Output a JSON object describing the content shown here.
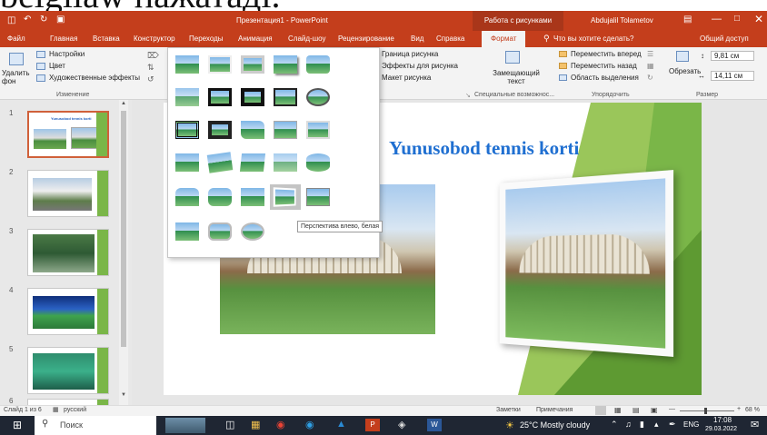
{
  "caption_text": "belgilaw нажатадi.",
  "app": {
    "title": "Презентация1 - PowerPoint",
    "context_tab": "Работа с рисунками",
    "user": "Abdujalil Tolametov"
  },
  "tabs": [
    "Файл",
    "Главная",
    "Вставка",
    "Конструктор",
    "Переходы",
    "Анимация",
    "Слайд-шоу",
    "Рецензирование",
    "Вид",
    "Справка",
    "Формат"
  ],
  "tell_me": "Что вы хотите сделать?",
  "share": "Общий доступ",
  "ribbon": {
    "remove_bg": "Удалить фон",
    "corrections": "Настройки",
    "color": "Цвет",
    "artistic": "Художественные эффекты",
    "group_adjust": "Изменение",
    "border": "Граница рисунка",
    "effects": "Эффекты для рисунка",
    "layout": "Макет рисунка",
    "alt_text": "Замещающий текст",
    "group_access": "Специальные возможнос...",
    "bring_forward": "Переместить вперед",
    "send_backward": "Переместить назад",
    "selection_pane": "Область выделения",
    "group_arrange": "Упорядочить",
    "crop": "Обрезать",
    "height": "9,81 см",
    "width": "14,11 см",
    "group_size": "Размер"
  },
  "slides": [
    "1",
    "2",
    "3",
    "4",
    "5",
    "6"
  ],
  "slide": {
    "title": "Yunusobod tennis korti",
    "thumb1_title": "Yunusobod tennis korti"
  },
  "tooltip": "Перспектива влево, белая",
  "status": {
    "slide_info": "Слайд 1 из 6",
    "lang": "русский",
    "notes": "Заметки",
    "comments": "Примечания",
    "zoom": "68 %"
  },
  "taskbar": {
    "search": "Поиск",
    "weather": "25°C  Mostly cloudy",
    "lang": "ENG",
    "time": "17:08",
    "date": "29.03.2022"
  },
  "colors": {
    "accent": "#c43e1c",
    "green": "#7ab648"
  }
}
